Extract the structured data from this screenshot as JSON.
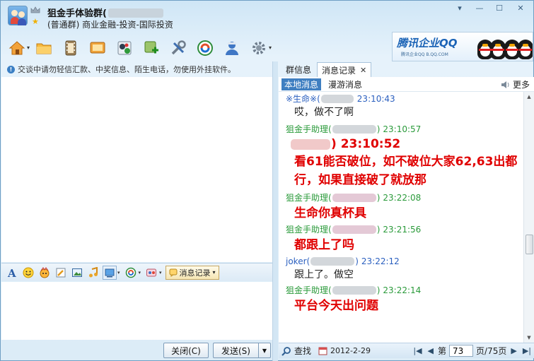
{
  "window": {
    "title": "狙金手体验群(",
    "subtitle": "(普通群) 商业金融-投资-国际投资",
    "controls": [
      "▾",
      "—",
      "☐",
      "✕"
    ]
  },
  "ad": {
    "brand": "腾讯企业QQ",
    "sub": "腾讯企业QQ  B.QQ.COM"
  },
  "left": {
    "notice": "交谈中请勿轻信汇款、中奖信息、陌生电话，勿使用外挂软件。",
    "msg_record_label": "消息记录",
    "close_label": "关闭(C)",
    "send_label": "发送(S)"
  },
  "right": {
    "tabs": [
      {
        "label": "群信息"
      },
      {
        "label": "消息记录",
        "close": "✕"
      }
    ],
    "subtabs": [
      "本地消息",
      "漫游消息"
    ],
    "more_label": "更多",
    "messages": [
      {
        "sender": "※生命※(",
        "sender_tail": "",
        "time": "23:10:43",
        "body": "哎，做不了啊"
      },
      {
        "sender": "狙金手助理(",
        "sender_tail": ")",
        "time": "23:10:57",
        "big_time_tail": ")  23:10:52",
        "body": "看61能否破位，如不破位大家62,63出都行，如果直接破了就放那"
      },
      {
        "sender": "狙金手助理(",
        "sender_tail": ")",
        "time": "23:22:08",
        "body": "生命你真杯具"
      },
      {
        "sender": "狙金手助理(",
        "sender_tail": ")",
        "time": "23:21:56",
        "body": "都跟上了吗"
      },
      {
        "sender": "joker(",
        "sender_tail": ")",
        "time": "23:22:12",
        "body": "跟上了。做空"
      },
      {
        "sender": "狙金手助理(",
        "sender_tail": ")",
        "time": "23:22:14",
        "body": "平台今天出问题"
      }
    ],
    "search_label": "查找",
    "date": "2012-2-29",
    "page_prefix": "第",
    "page_value": "73",
    "page_suffix": "页/75页"
  }
}
